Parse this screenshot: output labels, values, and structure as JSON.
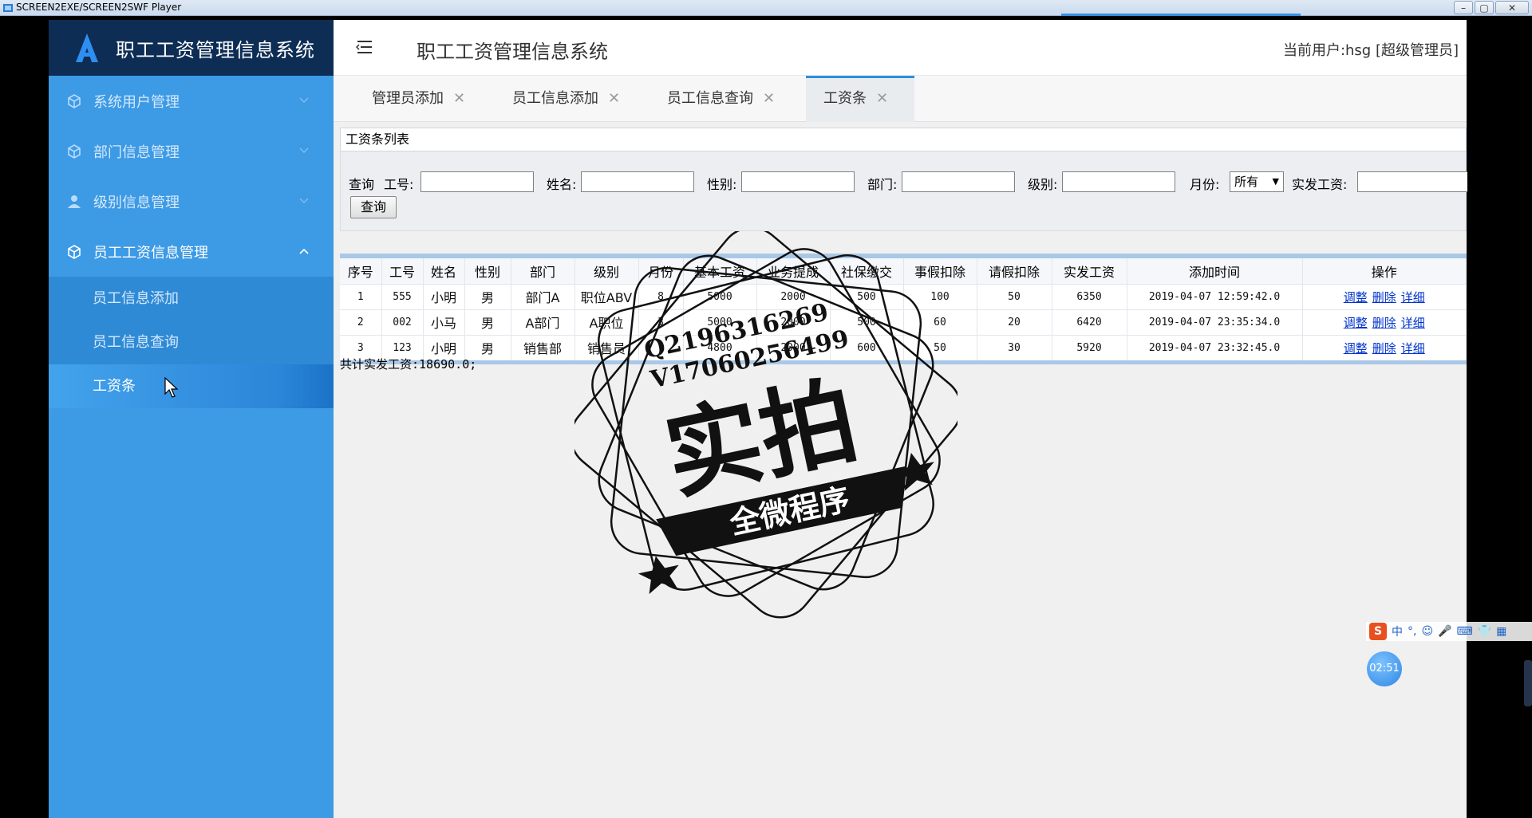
{
  "player": {
    "title": "SCREEN2EXE/SCREEN2SWF Player",
    "win_buttons": [
      "–",
      "▢",
      "✕"
    ]
  },
  "brand": {
    "name": "职工工资管理信息系统"
  },
  "sidebar": {
    "items": [
      {
        "label": "系统用户管理",
        "icon": "cube-icon"
      },
      {
        "label": "部门信息管理",
        "icon": "cube-icon"
      },
      {
        "label": "级别信息管理",
        "icon": "user-icon"
      },
      {
        "label": "员工工资信息管理",
        "icon": "cube-icon",
        "open": true
      }
    ],
    "subitems": [
      {
        "label": "员工信息添加"
      },
      {
        "label": "员工信息查询"
      },
      {
        "label": "工资条",
        "active": true
      }
    ]
  },
  "topbar": {
    "title": "职工工资管理信息系统",
    "user": "当前用户:hsg [超级管理员]"
  },
  "tabs": [
    {
      "label": "管理员添加"
    },
    {
      "label": "员工信息添加"
    },
    {
      "label": "员工信息查询"
    },
    {
      "label": "工资条",
      "active": true
    }
  ],
  "list": {
    "header": "工资条列表",
    "search": {
      "query_label": "查询",
      "id_label": "工号:",
      "name_label": "姓名:",
      "gender_label": "性别:",
      "dept_label": "部门:",
      "level_label": "级别:",
      "month_label": "月份:",
      "month_value": "所有",
      "pay_label": "实发工资:",
      "button": "查询"
    },
    "columns": [
      "序号",
      "工号",
      "姓名",
      "性别",
      "部门",
      "级别",
      "月份",
      "基本工资",
      "业务提成",
      "社保缴交",
      "事假扣除",
      "请假扣除",
      "实发工资",
      "添加时间",
      "操作"
    ],
    "rows": [
      [
        "1",
        "555",
        "小明",
        "男",
        "部门A",
        "职位ABV",
        "8",
        "5000",
        "2000",
        "500",
        "100",
        "50",
        "6350",
        "2019-04-07 12:59:42.0"
      ],
      [
        "2",
        "002",
        "小马",
        "男",
        "A部门",
        "A职位",
        "3",
        "5000",
        "2000",
        "500",
        "60",
        "20",
        "6420",
        "2019-04-07 23:35:34.0"
      ],
      [
        "3",
        "123",
        "小明",
        "男",
        "销售部",
        "销售员",
        "",
        "4800",
        "2000",
        "600",
        "50",
        "30",
        "5920",
        "2019-04-07 23:32:45.0"
      ]
    ],
    "ops": [
      "调整",
      "删除",
      "详细"
    ],
    "total": "共计实发工资:18690.0;"
  },
  "watermark": {
    "line1": "Q2196316269",
    "line2": "V17060256499",
    "big": "实拍",
    "banner": "全微程序"
  },
  "ime": {
    "items": [
      "S",
      "中",
      "°,",
      "☺",
      "🎤",
      "⌨",
      "👕",
      "▦"
    ]
  },
  "timer": "02:51"
}
